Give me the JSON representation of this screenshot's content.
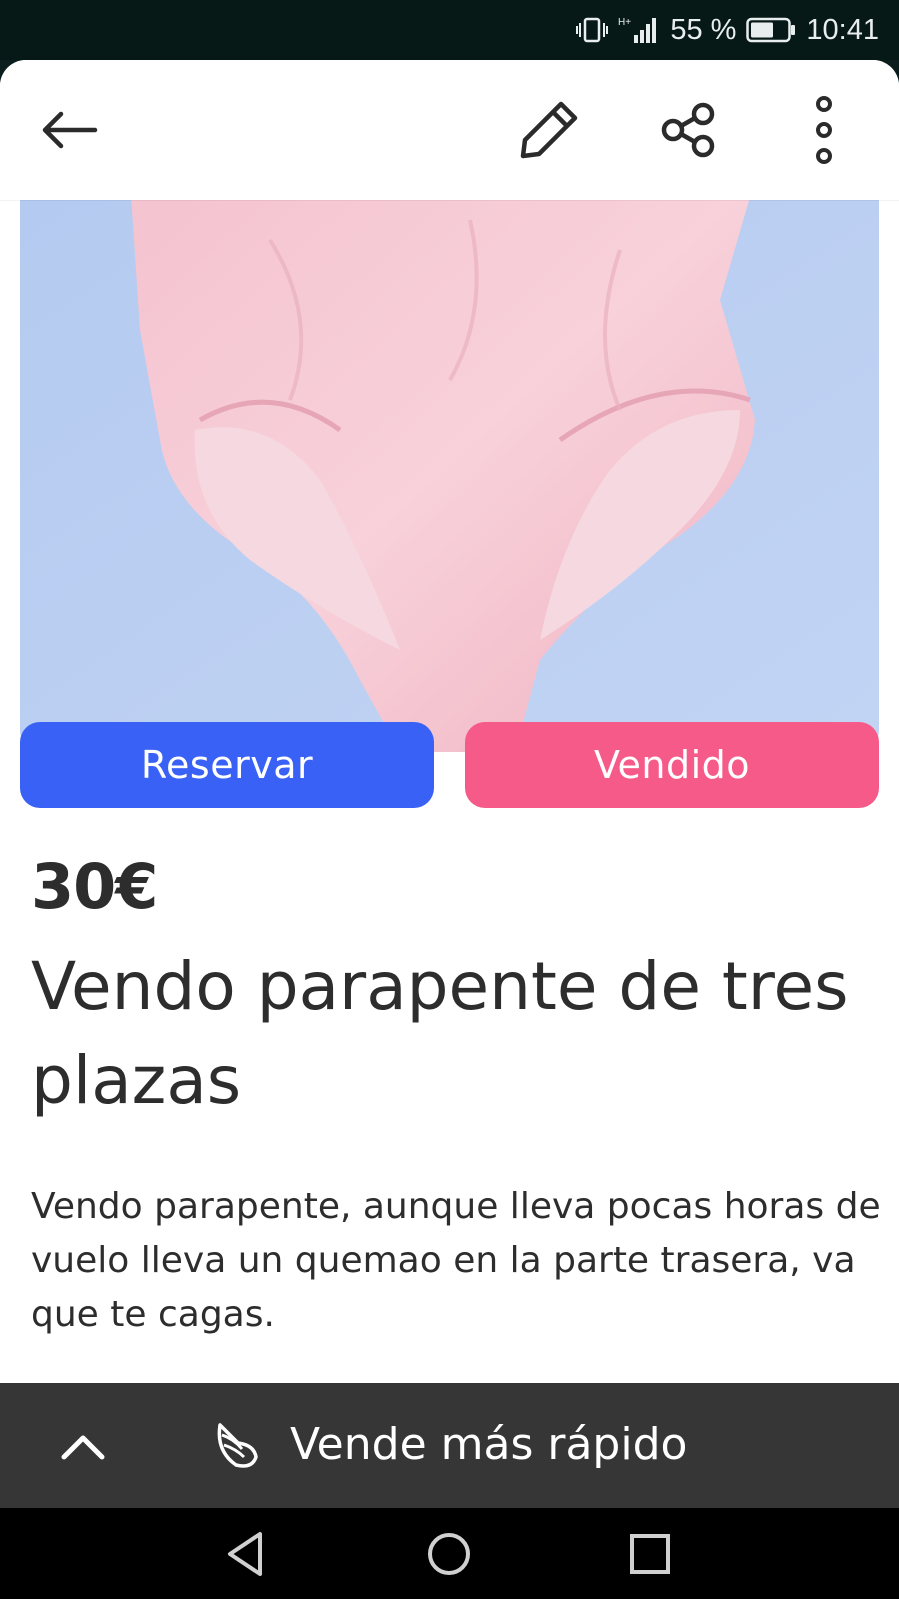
{
  "status_bar": {
    "battery_percent": "55 %",
    "time": "10:41",
    "icons": [
      "vibrate-icon",
      "signal-hplus-icon",
      "battery-icon"
    ]
  },
  "toolbar": {
    "icons": [
      "back-arrow-icon",
      "pencil-edit-icon",
      "share-icon",
      "more-vertical-icon"
    ]
  },
  "listing": {
    "actions": {
      "reserve_label": "Reservar",
      "sold_label": "Vendido"
    },
    "price": "30€",
    "title": "Vendo parapente de tres plazas",
    "description": "Vendo parapente, aunque lleva pocas horas de vuelo lleva un quemao en la parte trasera, va que te cagas."
  },
  "sell_faster_bar": {
    "label": "Vende más rápido",
    "icons": [
      "chevron-up-icon",
      "wing-icon"
    ]
  },
  "nav_bar": {
    "icons": [
      "nav-back-icon",
      "nav-home-icon",
      "nav-recents-icon"
    ]
  },
  "colors": {
    "reserve_button": "#3a61f6",
    "sold_button": "#f55a88",
    "sell_bar": "#363636",
    "status_bar": "#071917"
  }
}
